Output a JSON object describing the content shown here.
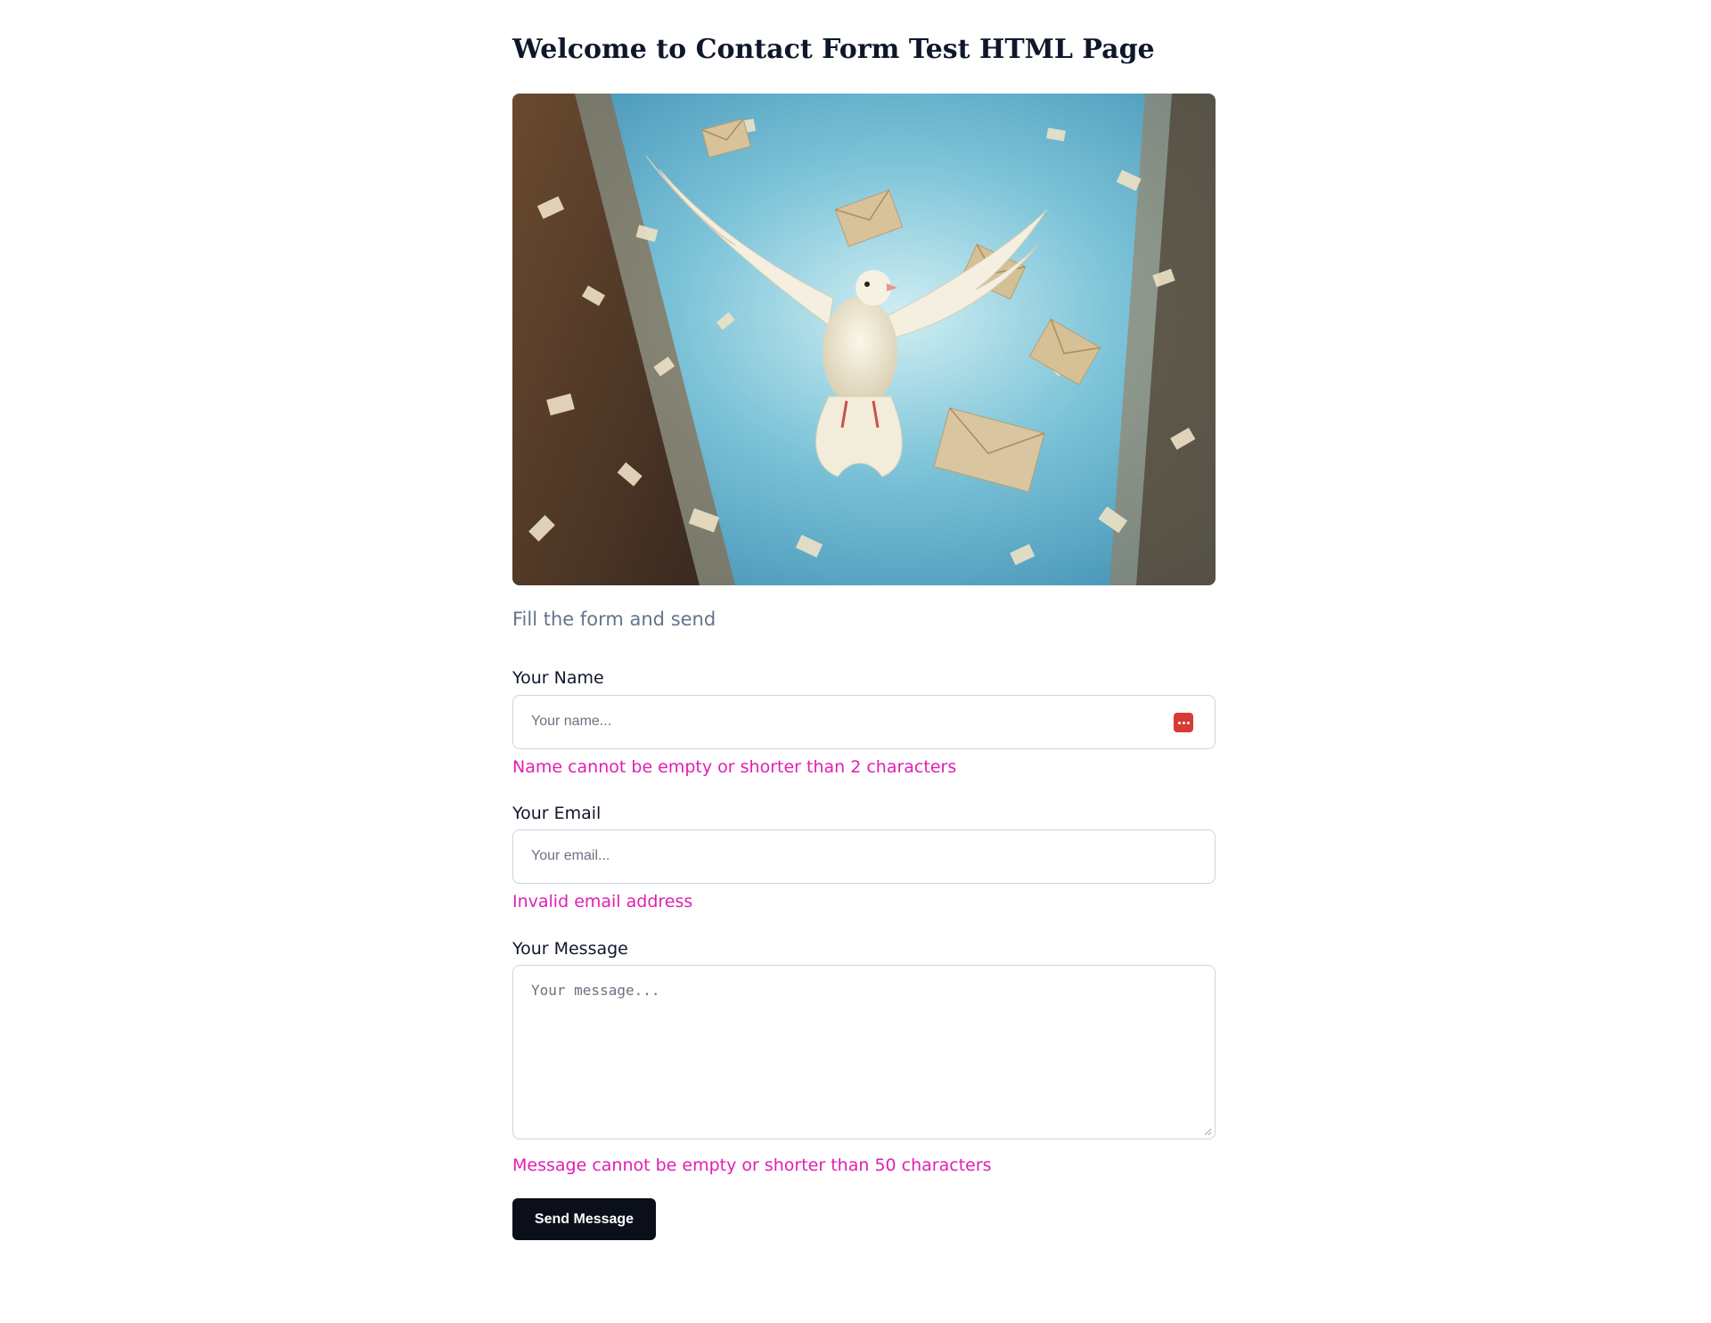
{
  "page": {
    "title": "Welcome to Contact Form Test HTML Page",
    "subtitle": "Fill the form and send"
  },
  "hero_image": {
    "description_icon": "dove-with-envelopes-image"
  },
  "form": {
    "name": {
      "label": "Your Name",
      "placeholder": "Your name...",
      "value": "",
      "error": "Name cannot be empty or shorter than 2 characters",
      "icon": "password-manager-icon"
    },
    "email": {
      "label": "Your Email",
      "placeholder": "Your email...",
      "value": "",
      "error": "Invalid email address"
    },
    "message": {
      "label": "Your Message",
      "placeholder": "Your message...",
      "value": "",
      "error": "Message cannot be empty or shorter than 50 characters"
    },
    "submit_label": "Send Message"
  },
  "colors": {
    "error": "#e11fb2",
    "button_bg": "#0b0f19",
    "subtitle": "#64748b",
    "password_icon": "#d93a35"
  }
}
